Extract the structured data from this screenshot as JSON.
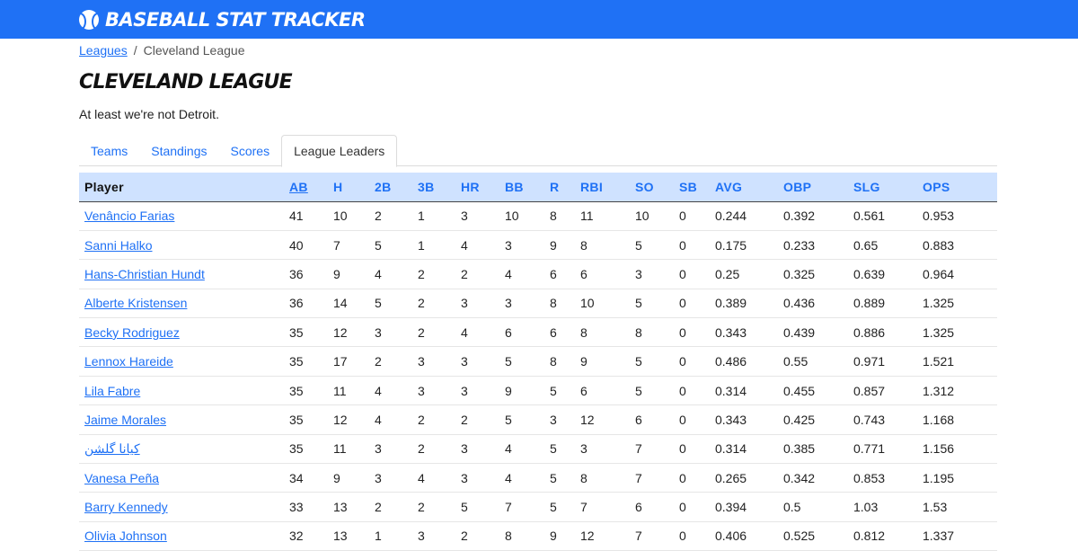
{
  "app": {
    "brand": "Baseball Stat Tracker",
    "logo_icon": "baseball-icon"
  },
  "breadcrumb": {
    "root": "Leagues",
    "separator": "/",
    "current": "Cleveland League"
  },
  "page": {
    "title": "Cleveland League",
    "tagline": "At least we're not Detroit."
  },
  "tabs": [
    {
      "label": "Teams",
      "active": false
    },
    {
      "label": "Standings",
      "active": false
    },
    {
      "label": "Scores",
      "active": false
    },
    {
      "label": "League Leaders",
      "active": true
    }
  ],
  "table": {
    "columns": [
      "Player",
      "AB",
      "H",
      "2B",
      "3B",
      "HR",
      "BB",
      "R",
      "RBI",
      "SO",
      "SB",
      "AVG",
      "OBP",
      "SLG",
      "OPS"
    ],
    "sorted_by": "AB",
    "rows": [
      [
        "Venâncio Farias",
        "41",
        "10",
        "2",
        "1",
        "3",
        "10",
        "8",
        "11",
        "10",
        "0",
        "0.244",
        "0.392",
        "0.561",
        "0.953"
      ],
      [
        "Sanni Halko",
        "40",
        "7",
        "5",
        "1",
        "4",
        "3",
        "9",
        "8",
        "5",
        "0",
        "0.175",
        "0.233",
        "0.65",
        "0.883"
      ],
      [
        "Hans-Christian Hundt",
        "36",
        "9",
        "4",
        "2",
        "2",
        "4",
        "6",
        "6",
        "3",
        "0",
        "0.25",
        "0.325",
        "0.639",
        "0.964"
      ],
      [
        "Alberte Kristensen",
        "36",
        "14",
        "5",
        "2",
        "3",
        "3",
        "8",
        "10",
        "5",
        "0",
        "0.389",
        "0.436",
        "0.889",
        "1.325"
      ],
      [
        "Becky Rodriguez",
        "35",
        "12",
        "3",
        "2",
        "4",
        "6",
        "6",
        "8",
        "8",
        "0",
        "0.343",
        "0.439",
        "0.886",
        "1.325"
      ],
      [
        "Lennox Hareide",
        "35",
        "17",
        "2",
        "3",
        "3",
        "5",
        "8",
        "9",
        "5",
        "0",
        "0.486",
        "0.55",
        "0.971",
        "1.521"
      ],
      [
        "Lila Fabre",
        "35",
        "11",
        "4",
        "3",
        "3",
        "9",
        "5",
        "6",
        "5",
        "0",
        "0.314",
        "0.455",
        "0.857",
        "1.312"
      ],
      [
        "Jaime Morales",
        "35",
        "12",
        "4",
        "2",
        "2",
        "5",
        "3",
        "12",
        "6",
        "0",
        "0.343",
        "0.425",
        "0.743",
        "1.168"
      ],
      [
        "کیانا گلشن",
        "35",
        "11",
        "3",
        "2",
        "3",
        "4",
        "5",
        "3",
        "7",
        "0",
        "0.314",
        "0.385",
        "0.771",
        "1.156"
      ],
      [
        "Vanesa Peña",
        "34",
        "9",
        "3",
        "4",
        "3",
        "4",
        "5",
        "8",
        "7",
        "0",
        "0.265",
        "0.342",
        "0.853",
        "1.195"
      ],
      [
        "Barry Kennedy",
        "33",
        "13",
        "2",
        "2",
        "5",
        "7",
        "5",
        "7",
        "6",
        "0",
        "0.394",
        "0.5",
        "1.03",
        "1.53"
      ],
      [
        "Olivia Johnson",
        "32",
        "13",
        "1",
        "3",
        "2",
        "8",
        "9",
        "12",
        "7",
        "0",
        "0.406",
        "0.525",
        "0.812",
        "1.337"
      ]
    ]
  },
  "colors": {
    "navbar": "#1f71f5",
    "link": "#1f71f5",
    "table_header_bg": "#cfe2ff"
  }
}
